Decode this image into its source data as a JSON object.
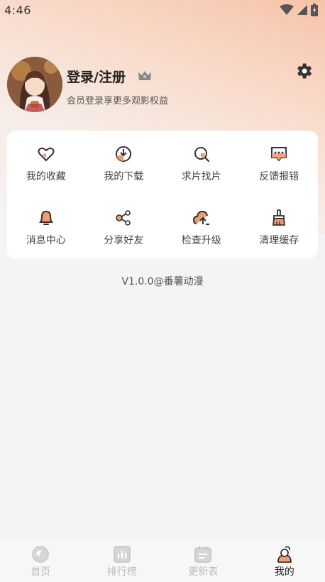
{
  "status_bar": {
    "time": "4:46"
  },
  "profile": {
    "title": "登录/注册",
    "subtitle": "会员登录享更多观影权益"
  },
  "menu": [
    {
      "label": "我的收藏",
      "icon": "heart-icon"
    },
    {
      "label": "我的下载",
      "icon": "download-icon"
    },
    {
      "label": "求片找片",
      "icon": "search-icon"
    },
    {
      "label": "反馈报错",
      "icon": "feedback-icon"
    },
    {
      "label": "消息中心",
      "icon": "bell-icon"
    },
    {
      "label": "分享好友",
      "icon": "share-icon"
    },
    {
      "label": "检查升级",
      "icon": "upgrade-icon"
    },
    {
      "label": "清理缓存",
      "icon": "broom-icon"
    }
  ],
  "version": "V1.0.0@番薯动漫",
  "tabs": [
    {
      "label": "首页",
      "icon": "home-icon",
      "active": false
    },
    {
      "label": "排行榜",
      "icon": "ranking-icon",
      "active": false
    },
    {
      "label": "更新表",
      "icon": "calendar-icon",
      "active": false
    },
    {
      "label": "我的",
      "icon": "profile-icon",
      "active": true
    }
  ],
  "colors": {
    "accent": "#f39a6e",
    "background": "#f5f4f4"
  }
}
